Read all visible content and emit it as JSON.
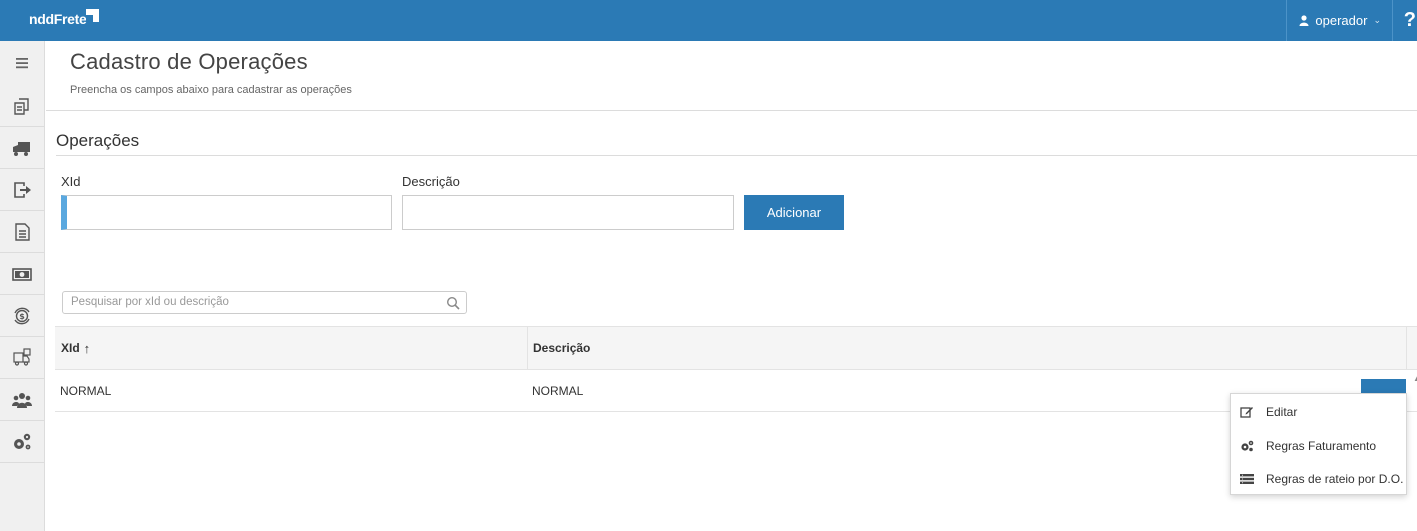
{
  "topbar": {
    "logo": "nddFrete",
    "user_label": "operador",
    "help_label": "?"
  },
  "sidebar": {
    "items": [
      {
        "icon": "menu-icon"
      },
      {
        "icon": "documents-icon"
      },
      {
        "icon": "truck-icon"
      },
      {
        "icon": "exit-icon"
      },
      {
        "icon": "file-text-icon"
      },
      {
        "icon": "money-icon"
      },
      {
        "icon": "money-cycle-icon"
      },
      {
        "icon": "truck-document-icon"
      },
      {
        "icon": "users-icon"
      },
      {
        "icon": "gears-icon"
      }
    ]
  },
  "page": {
    "title": "Cadastro de Operações",
    "subtitle": "Preencha os campos abaixo para cadastrar as operações"
  },
  "form": {
    "section_title": "Operações",
    "xid_label": "XId",
    "xid_value": "",
    "descricao_label": "Descrição",
    "descricao_value": "",
    "add_button": "Adicionar"
  },
  "search": {
    "placeholder": "Pesquisar por xId ou descrição"
  },
  "table": {
    "columns": [
      "XId",
      "Descrição"
    ],
    "sort_indicator": "↑",
    "rows": [
      {
        "xid": "NORMAL",
        "descricao": "NORMAL"
      }
    ]
  },
  "dropdown": {
    "items": [
      {
        "label": "Editar",
        "icon": "edit-icon"
      },
      {
        "label": "Regras Faturamento",
        "icon": "gears-icon"
      },
      {
        "label": "Regras de rateio por D.O.",
        "icon": "list-icon"
      }
    ]
  },
  "colors": {
    "brand": "#2b7ab5",
    "focus_accent": "#5aa8df"
  }
}
